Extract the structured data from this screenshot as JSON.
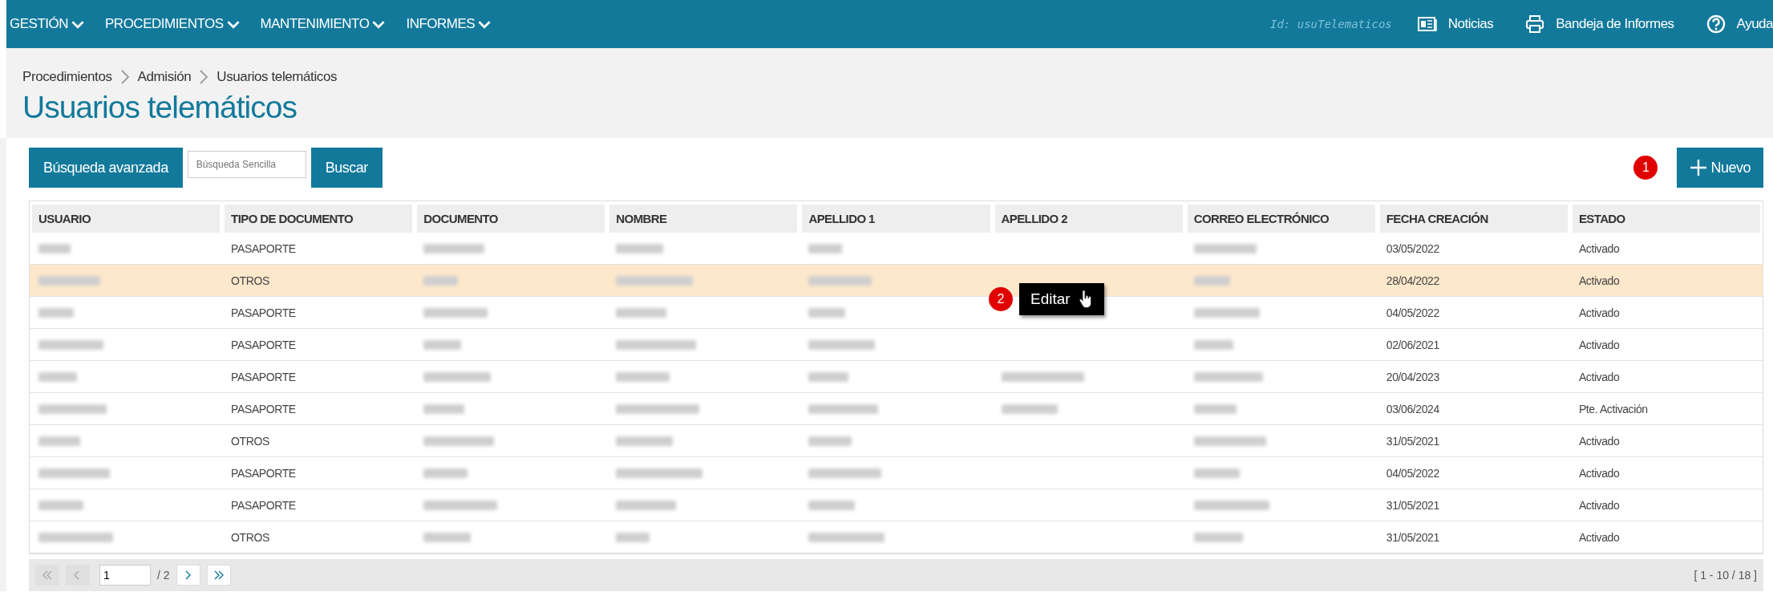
{
  "menu": [
    {
      "label": "GESTIÓN"
    },
    {
      "label": "PROCEDIMIENTOS"
    },
    {
      "label": "MANTENIMIENTO"
    },
    {
      "label": "INFORMES"
    }
  ],
  "screen_id": "Id: usuTelematicos",
  "top_links": [
    {
      "kind": "news",
      "label": "Noticias"
    },
    {
      "kind": "print",
      "label": "Bandeja de Informes"
    },
    {
      "kind": "help",
      "label": "Ayuda"
    }
  ],
  "breadcrumb": [
    "Procedimientos",
    "Admisión",
    "Usuarios telemáticos"
  ],
  "title": "Usuarios telemáticos",
  "toolbar": {
    "advanced_button": "Búsqueda avanzada",
    "search": {
      "placeholder": "Búsqueda Sencilla"
    },
    "search_button": "Buscar",
    "new_button": "Nuevo",
    "new_marker": "1"
  },
  "table": {
    "columns": [
      "USUARIO",
      "TIPO DE DOCUMENTO",
      "DOCUMENTO",
      "NOMBRE",
      "APELLIDO 1",
      "APELLIDO 2",
      "CORREO ELECTRÓNICO",
      "FECHA CREACIÓN",
      "ESTADO"
    ],
    "rows": [
      {
        "selected": false,
        "cells": [
          {
            "kind": "blurred"
          },
          {
            "kind": "text",
            "text": "PASAPORTE"
          },
          {
            "kind": "blurred"
          },
          {
            "kind": "blurred"
          },
          {
            "kind": "blurred"
          },
          {
            "kind": "empty"
          },
          {
            "kind": "blurred"
          },
          {
            "kind": "text",
            "text": "03/05/2022"
          },
          {
            "kind": "text",
            "text": "Activado"
          }
        ]
      },
      {
        "selected": true,
        "cells": [
          {
            "kind": "blurred"
          },
          {
            "kind": "text",
            "text": "OTROS"
          },
          {
            "kind": "blurred"
          },
          {
            "kind": "blurred"
          },
          {
            "kind": "blurred"
          },
          {
            "kind": "empty"
          },
          {
            "kind": "blurred"
          },
          {
            "kind": "text",
            "text": "28/04/2022"
          },
          {
            "kind": "text",
            "text": "Activado"
          }
        ]
      },
      {
        "selected": false,
        "cells": [
          {
            "kind": "blurred"
          },
          {
            "kind": "text",
            "text": "PASAPORTE"
          },
          {
            "kind": "blurred"
          },
          {
            "kind": "blurred"
          },
          {
            "kind": "blurred"
          },
          {
            "kind": "empty"
          },
          {
            "kind": "blurred"
          },
          {
            "kind": "text",
            "text": "04/05/2022"
          },
          {
            "kind": "text",
            "text": "Activado"
          }
        ]
      },
      {
        "selected": false,
        "cells": [
          {
            "kind": "blurred"
          },
          {
            "kind": "text",
            "text": "PASAPORTE"
          },
          {
            "kind": "blurred"
          },
          {
            "kind": "blurred"
          },
          {
            "kind": "blurred"
          },
          {
            "kind": "empty"
          },
          {
            "kind": "blurred"
          },
          {
            "kind": "text",
            "text": "02/06/2021"
          },
          {
            "kind": "text",
            "text": "Activado"
          }
        ]
      },
      {
        "selected": false,
        "cells": [
          {
            "kind": "blurred"
          },
          {
            "kind": "text",
            "text": "PASAPORTE"
          },
          {
            "kind": "blurred"
          },
          {
            "kind": "blurred"
          },
          {
            "kind": "blurred"
          },
          {
            "kind": "blurred"
          },
          {
            "kind": "blurred"
          },
          {
            "kind": "text",
            "text": "20/04/2023"
          },
          {
            "kind": "text",
            "text": "Activado"
          }
        ]
      },
      {
        "selected": false,
        "cells": [
          {
            "kind": "blurred"
          },
          {
            "kind": "text",
            "text": "PASAPORTE"
          },
          {
            "kind": "blurred"
          },
          {
            "kind": "blurred"
          },
          {
            "kind": "blurred"
          },
          {
            "kind": "blurred"
          },
          {
            "kind": "blurred"
          },
          {
            "kind": "text",
            "text": "03/06/2024"
          },
          {
            "kind": "text",
            "text": "Pte. Activación"
          }
        ]
      },
      {
        "selected": false,
        "cells": [
          {
            "kind": "blurred"
          },
          {
            "kind": "text",
            "text": "OTROS"
          },
          {
            "kind": "blurred"
          },
          {
            "kind": "blurred"
          },
          {
            "kind": "blurred"
          },
          {
            "kind": "empty"
          },
          {
            "kind": "blurred"
          },
          {
            "kind": "text",
            "text": "31/05/2021"
          },
          {
            "kind": "text",
            "text": "Activado"
          }
        ]
      },
      {
        "selected": false,
        "cells": [
          {
            "kind": "blurred"
          },
          {
            "kind": "text",
            "text": "PASAPORTE"
          },
          {
            "kind": "blurred"
          },
          {
            "kind": "blurred"
          },
          {
            "kind": "blurred"
          },
          {
            "kind": "empty"
          },
          {
            "kind": "blurred"
          },
          {
            "kind": "text",
            "text": "04/05/2022"
          },
          {
            "kind": "text",
            "text": "Activado"
          }
        ]
      },
      {
        "selected": false,
        "cells": [
          {
            "kind": "blurred"
          },
          {
            "kind": "text",
            "text": "PASAPORTE"
          },
          {
            "kind": "blurred"
          },
          {
            "kind": "blurred"
          },
          {
            "kind": "blurred"
          },
          {
            "kind": "empty"
          },
          {
            "kind": "blurred"
          },
          {
            "kind": "text",
            "text": "31/05/2021"
          },
          {
            "kind": "text",
            "text": "Activado"
          }
        ]
      },
      {
        "selected": false,
        "cells": [
          {
            "kind": "blurred"
          },
          {
            "kind": "text",
            "text": "OTROS"
          },
          {
            "kind": "blurred"
          },
          {
            "kind": "blurred"
          },
          {
            "kind": "blurred"
          },
          {
            "kind": "empty"
          },
          {
            "kind": "blurred"
          },
          {
            "kind": "text",
            "text": "31/05/2021"
          },
          {
            "kind": "text",
            "text": "Activado"
          }
        ]
      }
    ]
  },
  "context_menu": {
    "marker": "2",
    "item": "Editar"
  },
  "pagination": {
    "first_disabled": true,
    "prev_disabled": true,
    "page": "1",
    "total": "/ 2",
    "range": "[ 1 - 10 / 18 ]"
  }
}
